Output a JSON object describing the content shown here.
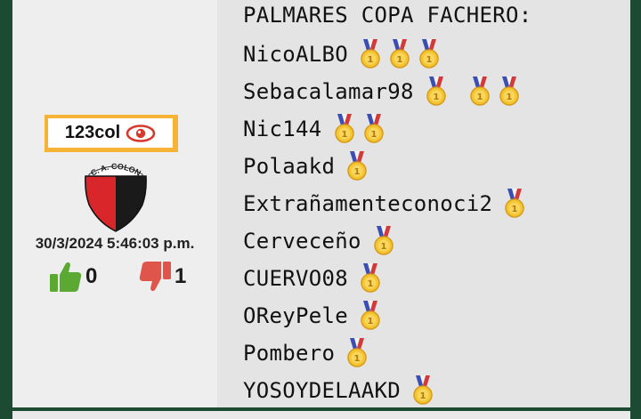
{
  "post": {
    "username": "123col",
    "crest_text": "C. A. COLON",
    "timestamp": "30/3/2024 5:46:03 p.m.",
    "likes": "0",
    "dislikes": "1",
    "icons": {
      "view": "eye-icon",
      "like": "thumbs-up-icon",
      "dislike": "thumbs-down-icon",
      "medal": "gold-medal-icon"
    },
    "colors": {
      "badge": "#f6b335",
      "eye": "#d63a2d",
      "like": "#5ba832",
      "dislike": "#e0554b",
      "crest_red": "#d8262b",
      "crest_black": "#1a1a1a",
      "background": "#1d4a33"
    }
  },
  "palmares": {
    "title": "PALMARES COPA FACHERO:",
    "entries": [
      {
        "name": "NicoALBO",
        "medals": 3
      },
      {
        "name": "Sebacalamar98",
        "medals": 3
      },
      {
        "name": "Nic144",
        "medals": 2
      },
      {
        "name": "Polaakd",
        "medals": 1
      },
      {
        "name": "Extrañamenteconoci2",
        "medals": 1
      },
      {
        "name": "Cerveceño",
        "medals": 1
      },
      {
        "name": "CUERVO08",
        "medals": 1
      },
      {
        "name": "OReyPele",
        "medals": 1
      },
      {
        "name": "Pombero",
        "medals": 1
      },
      {
        "name": "YOSOYDELAAKD",
        "medals": 1
      }
    ]
  }
}
